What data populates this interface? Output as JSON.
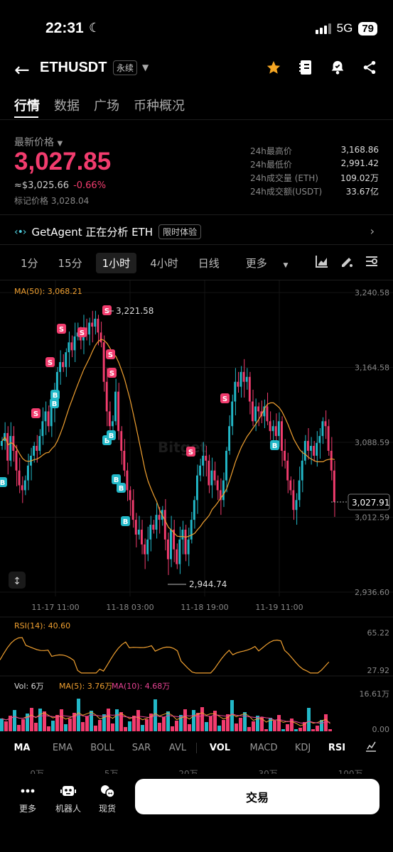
{
  "status": {
    "time": "22:31",
    "network": "5G",
    "battery": "79"
  },
  "header": {
    "symbol": "ETHUSDT",
    "contract_type": "永续"
  },
  "tabs": [
    "行情",
    "数据",
    "广场",
    "币种概况"
  ],
  "price": {
    "label": "最新价格",
    "last": "3,027.85",
    "usd": "≈$3,025.66",
    "change": "-0.66%",
    "mark_label": "标记价格",
    "mark": "3,028.04"
  },
  "stats": [
    {
      "k": "24h最高价",
      "v": "3,168.86"
    },
    {
      "k": "24h最低价",
      "v": "2,991.42"
    },
    {
      "k": "24h成交量 (ETH)",
      "v": "109.02万"
    },
    {
      "k": "24h成交额(USDT)",
      "v": "33.67亿"
    }
  ],
  "agent": {
    "name": "GetAgent",
    "text": "正在分析 ETH",
    "tag": "限时体验"
  },
  "intervals": [
    "1分",
    "15分",
    "1小时",
    "4小时",
    "日线",
    "更多"
  ],
  "chart_labels": {
    "ma": "MA(50): 3,068.21",
    "high": "3,221.58",
    "low": "2,944.74",
    "current": "3,027.91",
    "watermark": "Bitget",
    "rsi": "RSI(14): 40.60",
    "rsi_max": "65.22",
    "rsi_min": "27.92",
    "vol": "Vol: 6万",
    "vol_ma5": "MA(5): 3.76万",
    "vol_ma10": "MA(10): 4.68万",
    "vol_max": "16.61万",
    "vol_min": "0.00",
    "next_row": [
      "0万",
      "5万",
      "20万",
      "30万",
      "100万"
    ]
  },
  "chart_data": {
    "type": "candlestick",
    "y_ticks": [
      "3,240.58",
      "3,164.58",
      "3,088.59",
      "3,012.59",
      "2,936.60"
    ],
    "x_ticks": [
      "11-17 11:00",
      "11-18 03:00",
      "11-18 19:00",
      "11-19 11:00"
    ],
    "ylim": [
      2936.6,
      3240.58
    ]
  },
  "indicators": [
    "MA",
    "EMA",
    "BOLL",
    "SAR",
    "AVL",
    "VOL",
    "MACD",
    "KDJ",
    "RSI"
  ],
  "bottom": {
    "more": "更多",
    "bot": "机器人",
    "spot": "现货",
    "trade": "交易"
  },
  "colors": {
    "down": "#f23c6e",
    "up": "#22b8c8",
    "ma": "#f0a030"
  }
}
